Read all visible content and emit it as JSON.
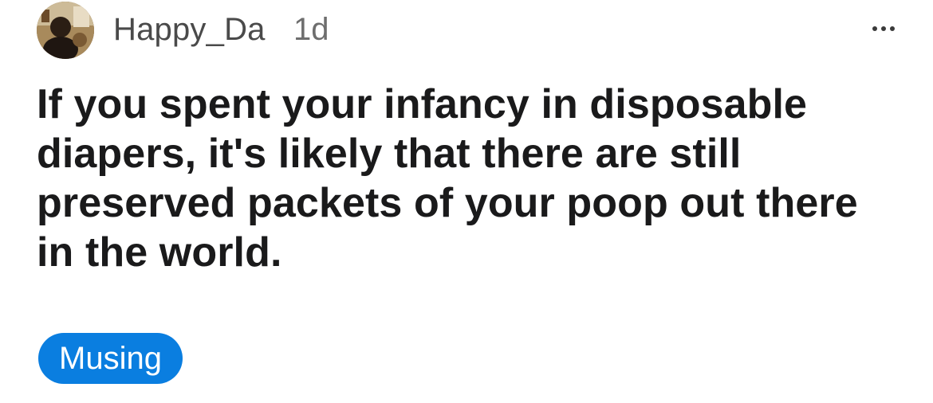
{
  "post": {
    "author": "Happy_Da",
    "age": "1d",
    "title": "If you spent your infancy in disposable diapers, it's likely that there are still preserved packets of your poop out there in the world.",
    "flair": "Musing",
    "more_icon": "more-horizontal-icon",
    "avatar_icon": "user-avatar-icon"
  },
  "colors": {
    "flair_background": "#0a7ee0",
    "flair_text": "#ffffff",
    "title_text": "#1a1a1b",
    "meta_text": "#4a4a4a"
  }
}
